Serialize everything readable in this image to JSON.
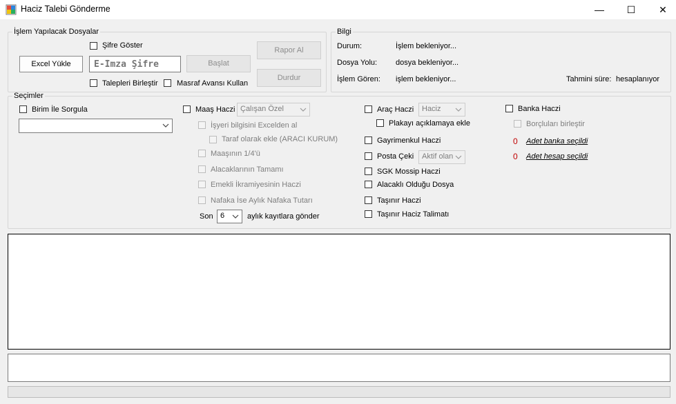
{
  "window": {
    "title": "Haciz Talebi Gönderme",
    "controls": {
      "minimize": "—",
      "maximize": "☐",
      "close": "✕"
    }
  },
  "files_group": {
    "legend": "İşlem Yapılacak Dosyalar",
    "excel_button": "Excel Yükle",
    "show_password_label": "Şifre Göster",
    "password_placeholder": "E-İmza Şifre",
    "start_button": "Başlat",
    "report_button": "Rapor Al",
    "stop_button": "Durdur",
    "merge_requests_label": "Talepleri Birleştir",
    "expense_advance_label": "Masraf Avansı Kullan"
  },
  "info_group": {
    "legend": "Bilgi",
    "status_label": "Durum:",
    "status_value": "İşlem bekleniyor...",
    "file_path_label": "Dosya Yolu:",
    "file_path_value": "dosya bekleniyor...",
    "processed_label": "İşlem Gören:",
    "processed_value": "işlem bekleniyor...",
    "eta_label": "Tahmini süre:",
    "eta_value": "hesaplanıyor"
  },
  "options_group": {
    "legend": "Seçimler",
    "unit_query_label": "Birim İle Sorgula",
    "unit_combo_value": "",
    "salary": {
      "label": "Maaş Haczi",
      "type_value": "Çalışan Özel",
      "employer_excel_label": "İşyeri bilgisini Excelden al",
      "add_party_label": "Taraf olarak ekle (ARACI KURUM)",
      "quarter_label": "Maaşının 1/4'ü",
      "full_receivables_label": "Alacaklarının Tamamı",
      "retirement_label": "Emekli İkramiyesinin Haczi",
      "alimony_label": "Nafaka İse Aylık Nafaka Tutarı",
      "last_label": "Son",
      "months_value": "6",
      "months_suffix": "aylık kayıtlara gönder"
    },
    "vehicle": {
      "label": "Araç Haczi",
      "type_value": "Haciz",
      "plate_note_label": "Plakayı açıklamaya ekle"
    },
    "real_estate_label": "Gayrimenkul Haczi",
    "postal_check_label": "Posta Çeki",
    "postal_check_value": "Aktif olan",
    "sgk_label": "SGK Mossip Haczi",
    "creditor_file_label": "Alacaklı Olduğu Dosya",
    "movable_label": "Taşınır Haczi",
    "movable_instruction_label": "Taşınır Haciz Talimatı",
    "bank": {
      "label": "Banka Haczi",
      "merge_debtors_label": "Borçluları birleştir",
      "bank_count": "0",
      "bank_link": "Adet banka seçildi",
      "account_count": "0",
      "account_link": "Adet hesap seçildi"
    }
  },
  "log_text": "",
  "status_text": "",
  "progress_value": 0
}
